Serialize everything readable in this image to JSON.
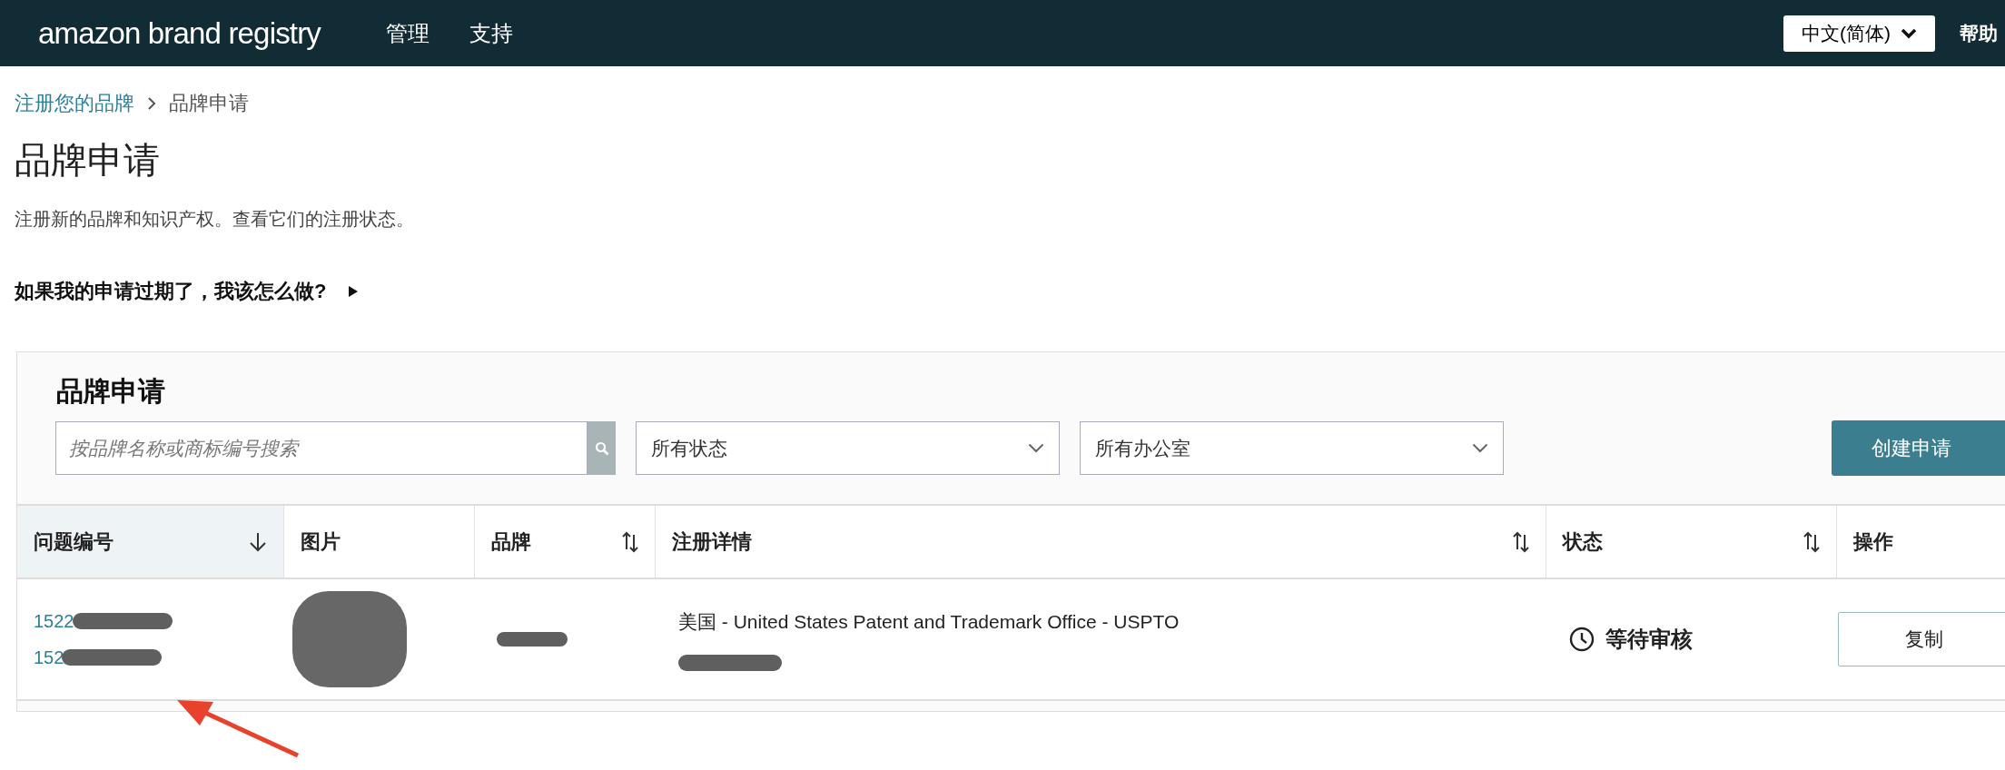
{
  "header": {
    "logo": "amazon brand registry",
    "nav": [
      "管理",
      "支持"
    ],
    "language": "中文(简体)",
    "help": "帮助"
  },
  "breadcrumb": [
    {
      "label": "注册您的品牌",
      "kind": "link"
    },
    {
      "label": "品牌申请",
      "kind": "current"
    }
  ],
  "page_title": "品牌申请",
  "subtitle": "注册新的品牌和知识产权。查看它们的注册状态。",
  "faq": {
    "label": "如果我的申请过期了，我该怎么做?",
    "expanded": false
  },
  "panel": {
    "title": "品牌申请",
    "search": {
      "placeholder": "按品牌名称或商标编号搜索"
    },
    "filters": [
      "所有状态",
      "所有办公室"
    ],
    "create_button": "创建申请",
    "table": {
      "columns": [
        {
          "label": "问题编号",
          "sortable": true,
          "sorted": true
        },
        {
          "label": "图片",
          "sortable": false,
          "sorted": false
        },
        {
          "label": "品牌",
          "sortable": true,
          "sorted": false
        },
        {
          "label": "注册详情",
          "sortable": true,
          "sorted": false
        },
        {
          "label": "状态",
          "sortable": true,
          "sorted": false
        },
        {
          "label": "操作",
          "sortable": false,
          "sorted": false
        }
      ],
      "rows": [
        {
          "issue_numbers": [
            "1522",
            "152"
          ],
          "details": "美国 - United States Patent and Trademark Office - USPTO",
          "status": "等待审核",
          "action": "复制"
        }
      ]
    }
  }
}
